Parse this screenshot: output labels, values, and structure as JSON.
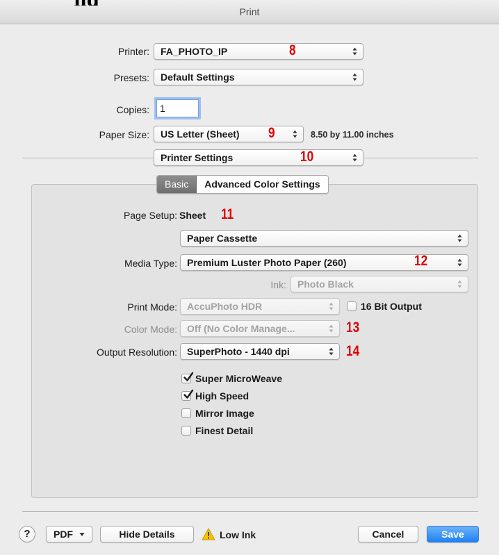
{
  "window": {
    "title": "Print",
    "cut_heading": "ng"
  },
  "printer": {
    "label": "Printer:",
    "value": "FA_PHOTO_IP",
    "annotation": "8"
  },
  "presets": {
    "label": "Presets:",
    "value": "Default Settings"
  },
  "copies": {
    "label": "Copies:",
    "value": "1"
  },
  "paper_size": {
    "label": "Paper Size:",
    "value": "US Letter (Sheet)",
    "annotation": "9",
    "dimensions": "8.50 by 11.00 inches"
  },
  "section": {
    "value": "Printer Settings",
    "annotation": "10"
  },
  "tabs": [
    {
      "label": "Basic",
      "selected": true
    },
    {
      "label": "Advanced Color Settings",
      "selected": false
    }
  ],
  "panel": {
    "page_setup": {
      "label": "Page Setup:",
      "value": "Sheet",
      "annotation": "11"
    },
    "paper_source": {
      "value": "Paper Cassette"
    },
    "media_type": {
      "label": "Media Type:",
      "value": "Premium Luster Photo Paper (260)",
      "annotation": "12"
    },
    "ink": {
      "label": "Ink:",
      "value": "Photo Black",
      "enabled": false
    },
    "print_mode": {
      "label": "Print Mode:",
      "value": "AccuPhoto HDR",
      "enabled": false
    },
    "bit_output": {
      "label": "16 Bit Output",
      "checked": false
    },
    "color_mode": {
      "label": "Color Mode:",
      "value": "Off (No Color Manage...",
      "annotation": "13",
      "enabled": false
    },
    "output_resolution": {
      "label": "Output Resolution:",
      "value": "SuperPhoto - 1440 dpi",
      "annotation": "14"
    },
    "options": [
      {
        "label": "Super MicroWeave",
        "checked": true
      },
      {
        "label": "High Speed",
        "checked": true
      },
      {
        "label": "Mirror Image",
        "checked": false
      },
      {
        "label": "Finest Detail",
        "checked": false
      }
    ]
  },
  "footer": {
    "help": "?",
    "pdf": "PDF",
    "hide_details": "Hide Details",
    "status": "Low Ink",
    "cancel": "Cancel",
    "save": "Save"
  },
  "colors": {
    "annotation": "#e00000",
    "primary_button": "#2a86f3",
    "warning": "#f5c400"
  }
}
